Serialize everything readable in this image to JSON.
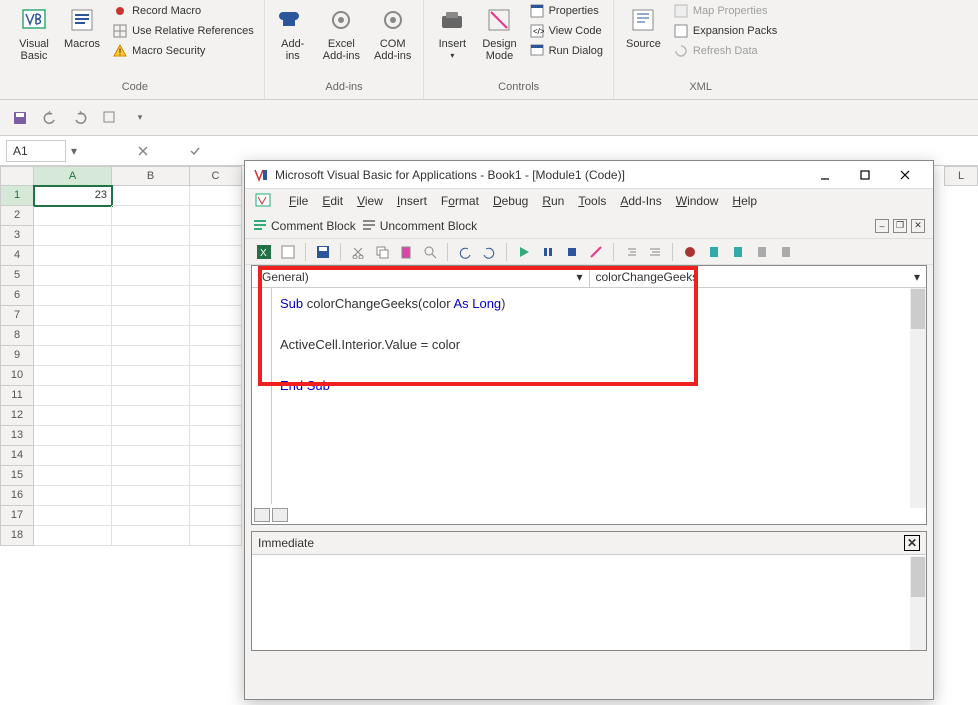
{
  "ribbon": {
    "groups": {
      "code": {
        "label": "Code",
        "visual_basic": "Visual\nBasic",
        "macros": "Macros",
        "record_macro": "Record Macro",
        "relative_refs": "Use Relative References",
        "macro_security": "Macro Security"
      },
      "addins": {
        "label": "Add-ins",
        "addins": "Add-\nins",
        "excel_addins": "Excel\nAdd-ins",
        "com_addins": "COM\nAdd-ins"
      },
      "controls": {
        "label": "Controls",
        "insert": "Insert",
        "design_mode": "Design\nMode",
        "properties": "Properties",
        "view_code": "View Code",
        "run_dialog": "Run Dialog"
      },
      "xml": {
        "label": "XML",
        "source": "Source",
        "map_properties": "Map Properties",
        "expansion_packs": "Expansion Packs",
        "refresh_data": "Refresh Data"
      }
    }
  },
  "namebox": {
    "value": "A1"
  },
  "sheet": {
    "columns": [
      "A",
      "B",
      "C"
    ],
    "far_column": "L",
    "rows": [
      1,
      2,
      3,
      4,
      5,
      6,
      7,
      8,
      9,
      10,
      11,
      12,
      13,
      14,
      15,
      16,
      17,
      18
    ],
    "a1_value": "23"
  },
  "vba": {
    "title": "Microsoft Visual Basic for Applications - Book1 - [Module1 (Code)]",
    "menu": [
      "File",
      "Edit",
      "View",
      "Insert",
      "Format",
      "Debug",
      "Run",
      "Tools",
      "Add-Ins",
      "Window",
      "Help"
    ],
    "comment_block": "Comment Block",
    "uncomment_block": "Uncomment Block",
    "dropdowns": {
      "left": "(General)",
      "right": "colorChangeGeeks"
    },
    "code": {
      "l1a": "Sub",
      "l1b": " colorChangeGeeks(color ",
      "l1c": "As Long",
      "l1d": ")",
      "l2": "ActiveCell.Interior.Value = color",
      "l3": "End Sub"
    },
    "immediate_title": "Immediate"
  }
}
